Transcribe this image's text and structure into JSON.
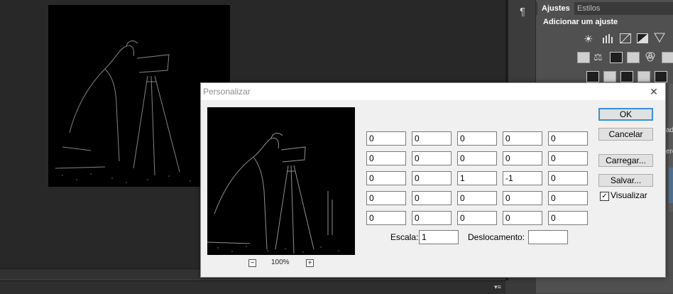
{
  "workspace": {
    "status_menu_icon": "▾≡"
  },
  "panel": {
    "tabs": [
      {
        "label": "Ajustes"
      },
      {
        "label": "Estilos"
      }
    ],
    "heading": "Adicionar um ajuste",
    "edge_labels": [
      "ado",
      "ere"
    ]
  },
  "dialog": {
    "title": "Personalizar",
    "close_icon": "✕",
    "zoom": "100%",
    "zoom_out": "−",
    "zoom_in": "+",
    "matrix": [
      [
        "0",
        "0",
        "0",
        "0",
        "0"
      ],
      [
        "0",
        "0",
        "0",
        "0",
        "0"
      ],
      [
        "0",
        "0",
        "1",
        "-1",
        "0"
      ],
      [
        "0",
        "0",
        "0",
        "0",
        "0"
      ],
      [
        "0",
        "0",
        "0",
        "0",
        "0"
      ]
    ],
    "scale_label": "Escala:",
    "scale_value": "1",
    "offset_label": "Deslocamento:",
    "offset_value": "",
    "buttons": {
      "ok": "OK",
      "cancel": "Cancelar",
      "load": "Carregar...",
      "save": "Salvar..."
    },
    "preview_checkbox": {
      "label": "Visualizar",
      "checked": true,
      "mark": "✓"
    }
  },
  "colors": {
    "workspace_bg": "#282828",
    "panel_bg": "#505050",
    "dialog_bg": "#f0f0f0",
    "ok_border": "#3c8fd9"
  }
}
